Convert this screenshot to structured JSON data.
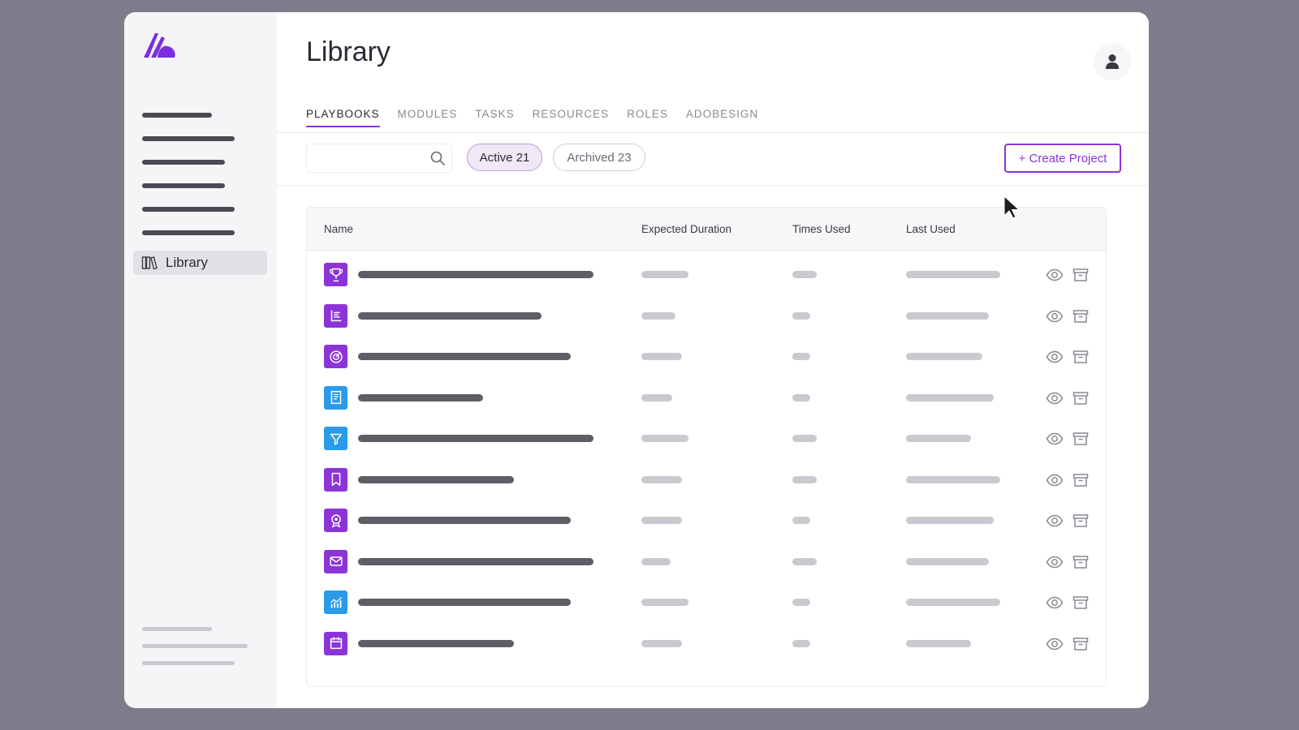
{
  "sidebar": {
    "library_label": "Library",
    "nav_placeholder_widths": [
      86,
      114,
      102,
      102,
      114,
      114
    ],
    "footer_placeholder_widths": [
      86,
      130,
      114
    ]
  },
  "header": {
    "title": "Library"
  },
  "tabs": [
    {
      "label": "PLAYBOOKS",
      "active": true
    },
    {
      "label": "MODULES",
      "active": false
    },
    {
      "label": "TASKS",
      "active": false
    },
    {
      "label": "RESOURCES",
      "active": false
    },
    {
      "label": "ROLES",
      "active": false
    },
    {
      "label": "ADOBESIGN",
      "active": false
    }
  ],
  "toolbar": {
    "search_placeholder": "",
    "active_filter": "Active 21",
    "archived_filter": "Archived 23",
    "create_label": "+ Create Project"
  },
  "table": {
    "columns": [
      "Name",
      "Expected Duration",
      "Times Used",
      "Last Used"
    ],
    "rows": [
      {
        "icon": "trophy-icon",
        "icon_color": "#8b35d8",
        "name_w": 290,
        "dur_w": 58,
        "times_w": 30,
        "last_w": 116
      },
      {
        "icon": "list-icon",
        "icon_color": "#8b35d8",
        "name_w": 226,
        "dur_w": 42,
        "times_w": 22,
        "last_w": 102
      },
      {
        "icon": "target-icon",
        "icon_color": "#8b35d8",
        "name_w": 262,
        "dur_w": 50,
        "times_w": 22,
        "last_w": 94
      },
      {
        "icon": "document-icon",
        "icon_color": "#2a9be8",
        "name_w": 154,
        "dur_w": 38,
        "times_w": 22,
        "last_w": 108
      },
      {
        "icon": "filter-icon",
        "icon_color": "#2a9be8",
        "name_w": 290,
        "dur_w": 58,
        "times_w": 30,
        "last_w": 80
      },
      {
        "icon": "bookmark-icon",
        "icon_color": "#8b35d8",
        "name_w": 192,
        "dur_w": 50,
        "times_w": 30,
        "last_w": 116
      },
      {
        "icon": "badge-icon",
        "icon_color": "#8b35d8",
        "name_w": 262,
        "dur_w": 50,
        "times_w": 22,
        "last_w": 108
      },
      {
        "icon": "mail-icon",
        "icon_color": "#8b35d8",
        "name_w": 290,
        "dur_w": 36,
        "times_w": 30,
        "last_w": 102
      },
      {
        "icon": "chart-icon",
        "icon_color": "#2a9be8",
        "name_w": 262,
        "dur_w": 58,
        "times_w": 22,
        "last_w": 116
      },
      {
        "icon": "calendar-icon",
        "icon_color": "#8b35d8",
        "name_w": 192,
        "dur_w": 50,
        "times_w": 22,
        "last_w": 80
      }
    ]
  },
  "colors": {
    "accent": "#8b35d8",
    "accent_blue": "#2a9be8"
  }
}
